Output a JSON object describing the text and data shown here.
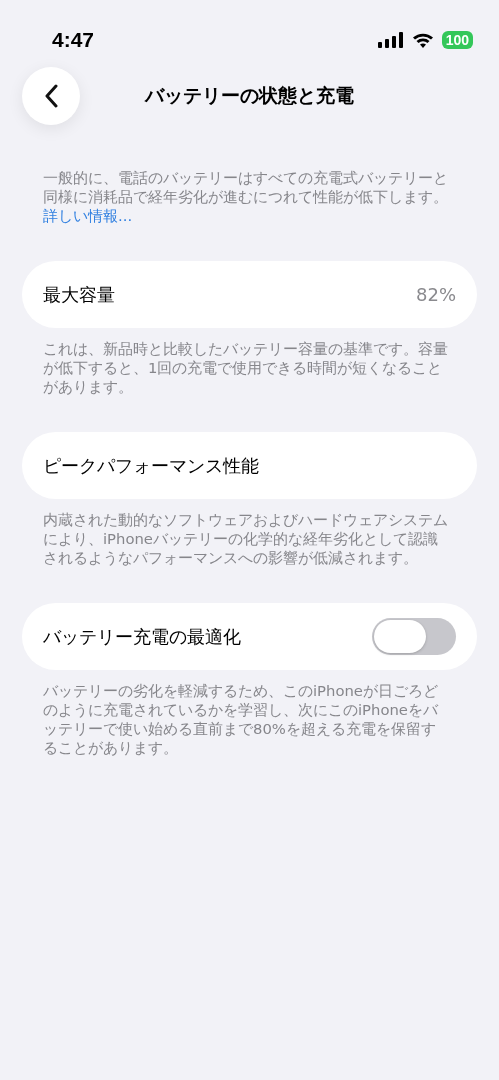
{
  "status_bar": {
    "time": "4:47",
    "battery": "100"
  },
  "nav": {
    "title": "バッテリーの状態と充電"
  },
  "intro": {
    "text": "一般的に、電話のバッテリーはすべての充電式バッテリーと同様に消耗品で経年劣化が進むにつれて性能が低下します。",
    "link": "詳しい情報..."
  },
  "sections": [
    {
      "kind": "value",
      "label": "最大容量",
      "value": "82%",
      "footer": "これは、新品時と比較したバッテリー容量の基準です。容量が低下すると、1回の充電で使用できる時間が短くなることがあります。"
    },
    {
      "kind": "plain",
      "label": "ピークパフォーマンス性能",
      "footer": "内蔵された動的なソフトウェアおよびハードウェアシステムにより、iPhoneバッテリーの化学的な経年劣化として認識されるようなパフォーマンスへの影響が低減されます。"
    },
    {
      "kind": "toggle",
      "label": "バッテリー充電の最適化",
      "on": false,
      "footer": "バッテリーの劣化を軽減するため、このiPhoneが日ごろどのように充電されているかを学習し、次にこのiPhoneをバッテリーで使い始める直前まで80%を超える充電を保留することがあります。"
    }
  ]
}
